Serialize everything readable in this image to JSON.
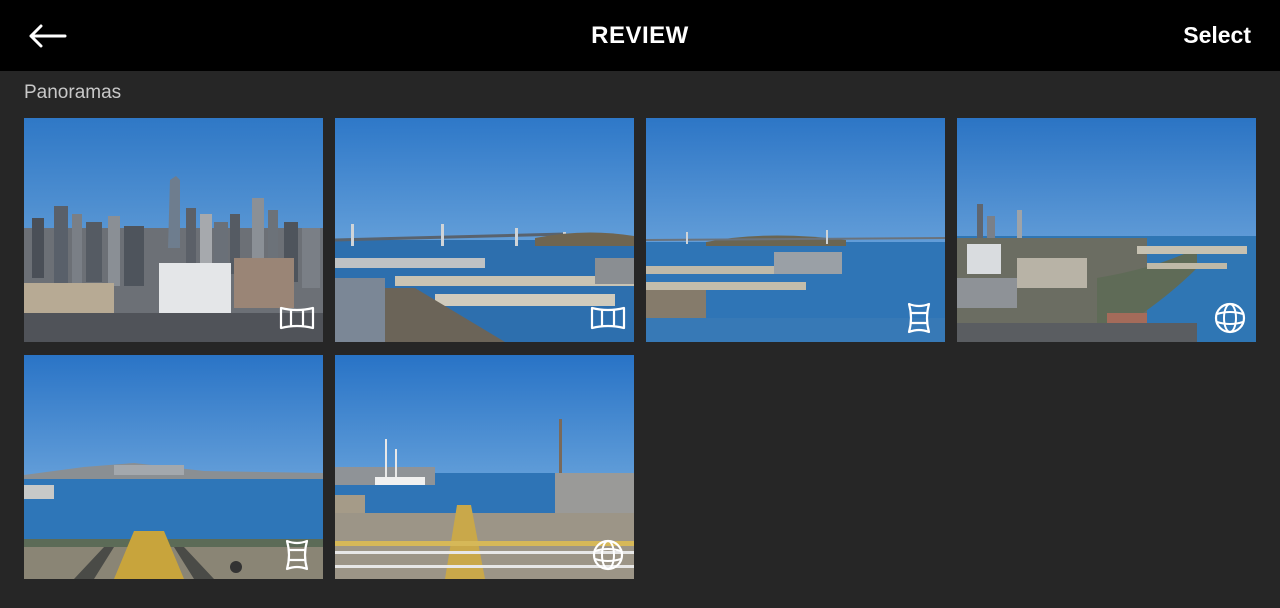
{
  "header": {
    "back_icon": "arrow-left-icon",
    "title": "REVIEW",
    "select_label": "Select"
  },
  "section": {
    "label": "Panoramas"
  },
  "colors": {
    "topbar": "#000000",
    "background": "#262626",
    "sky": "#3f86cf",
    "water": "#2f78b8"
  },
  "thumbnails": [
    {
      "scene": "city-skyline",
      "type_icon": "wide-panorama-icon"
    },
    {
      "scene": "bay-bridge",
      "type_icon": "wide-panorama-icon"
    },
    {
      "scene": "bay-piers",
      "type_icon": "vertical-panorama-icon"
    },
    {
      "scene": "waterfront-city",
      "type_icon": "sphere-panorama-icon"
    },
    {
      "scene": "shoreline",
      "type_icon": "vertical-panorama-icon"
    },
    {
      "scene": "pier-dock",
      "type_icon": "sphere-panorama-icon"
    }
  ]
}
